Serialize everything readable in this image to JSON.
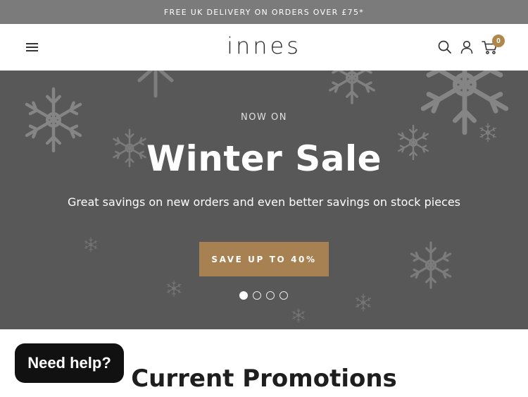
{
  "announcement": {
    "text": "FREE UK DELIVERY ON ORDERS OVER £75*"
  },
  "header": {
    "logo": "innes",
    "cart_count": "0",
    "icons": [
      "menu-icon",
      "search-icon",
      "account-icon",
      "cart-icon"
    ]
  },
  "hero": {
    "eyebrow": "NOW ON",
    "title": "Winter Sale",
    "subtitle": "Great savings on new orders and even better savings on stock pieces",
    "cta_label": "SAVE UP TO 40%",
    "slide_count": 4,
    "active_slide": 1,
    "background_color": "#585858",
    "cta_color": "#a88152"
  },
  "chat": {
    "label": "Need help?"
  },
  "section": {
    "title": "Current Promotions"
  },
  "colors": {
    "announcement_bg": "#7b7b7b",
    "badge": "#b0874b"
  }
}
